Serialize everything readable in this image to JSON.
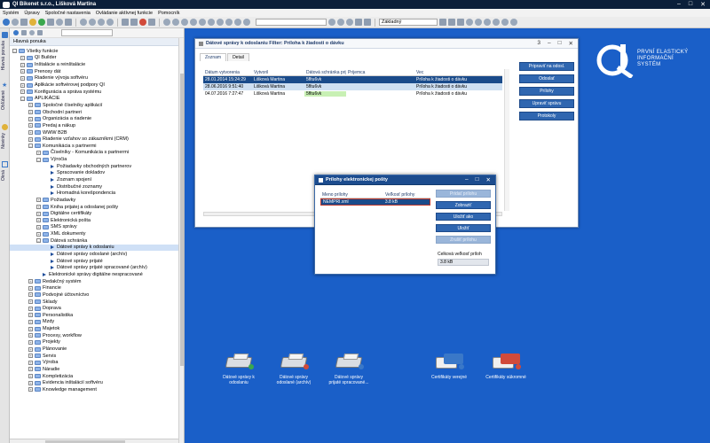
{
  "window": {
    "title": "QI  Bikenet s.r.o., Lišková Martina",
    "controls": [
      "–",
      "□",
      "✕"
    ]
  },
  "menu": [
    "Systém",
    "Úpravy",
    "Spoločné nastavenia",
    "Ovládanie aktívnej funkcie",
    "Pomocník"
  ],
  "toolbar": {
    "combo1": "",
    "combo2": "Základný"
  },
  "left_strip": [
    "Hlavná ponuka",
    "Obľúbené",
    "Novinky",
    "Okná"
  ],
  "left_panel": {
    "title": "Hlavná ponuka",
    "tree": [
      {
        "d": 0,
        "k": "fold",
        "e": "–",
        "t": "Všetky funkcie"
      },
      {
        "d": 1,
        "k": "fold",
        "e": "+",
        "t": "QI Builder"
      },
      {
        "d": 1,
        "k": "fold",
        "e": "+",
        "t": "Inštalácie a reinštalácie"
      },
      {
        "d": 1,
        "k": "fold",
        "e": "+",
        "t": "Prenosy dát"
      },
      {
        "d": 1,
        "k": "fold",
        "e": "+",
        "t": "Riadenie vývoja softvéru"
      },
      {
        "d": 1,
        "k": "fold",
        "e": "+",
        "t": "Aplikácie softvérovej podpory QI"
      },
      {
        "d": 1,
        "k": "fold",
        "e": "+",
        "t": "Konfigurácia a správa systému"
      },
      {
        "d": 1,
        "k": "fold",
        "e": "–",
        "t": "APLIKÁCIE"
      },
      {
        "d": 2,
        "k": "fold",
        "e": "+",
        "t": "Spoločné číselníky aplikácií"
      },
      {
        "d": 2,
        "k": "fold",
        "e": "+",
        "t": "Obchodní partneri"
      },
      {
        "d": 2,
        "k": "fold",
        "e": "+",
        "t": "Organizácia a riadenie"
      },
      {
        "d": 2,
        "k": "fold",
        "e": "+",
        "t": "Predaj a nákup"
      },
      {
        "d": 2,
        "k": "fold",
        "e": "+",
        "t": "WWW B2B"
      },
      {
        "d": 2,
        "k": "fold",
        "e": "+",
        "t": "Riadenie vzťahov so zákazníkmi (CRM)"
      },
      {
        "d": 2,
        "k": "fold",
        "e": "–",
        "t": "Komunikácia s partnermi"
      },
      {
        "d": 3,
        "k": "fold",
        "e": "+",
        "t": "Číselníky - Komunikácia s partnermi"
      },
      {
        "d": 3,
        "k": "fold",
        "e": "–",
        "t": "Výročia"
      },
      {
        "d": 4,
        "k": "leaf",
        "e": "",
        "t": "Požiadavky obchodných partnerov"
      },
      {
        "d": 4,
        "k": "leaf",
        "e": "",
        "t": "Spracovanie dokladov"
      },
      {
        "d": 4,
        "k": "leaf",
        "e": "",
        "t": "Zoznam spojení"
      },
      {
        "d": 4,
        "k": "leaf",
        "e": "",
        "t": "Distribučné zoznamy"
      },
      {
        "d": 4,
        "k": "leaf",
        "e": "",
        "t": "Hromadná korešpondencia"
      },
      {
        "d": 3,
        "k": "fold",
        "e": "+",
        "t": "Požiadavky"
      },
      {
        "d": 3,
        "k": "fold",
        "e": "+",
        "t": "Kniha prijatej a odoslanej pošty"
      },
      {
        "d": 3,
        "k": "fold",
        "e": "+",
        "t": "Digitálne certifikáty"
      },
      {
        "d": 3,
        "k": "fold",
        "e": "+",
        "t": "Elektronická pošta"
      },
      {
        "d": 3,
        "k": "fold",
        "e": "+",
        "t": "SMS správy"
      },
      {
        "d": 3,
        "k": "fold",
        "e": "+",
        "t": "XML dokumenty"
      },
      {
        "d": 3,
        "k": "fold",
        "e": "–",
        "t": "Dátová schránka"
      },
      {
        "d": 4,
        "k": "leaf",
        "e": "",
        "t": "Dátové správy k odoslaniu",
        "sel": true
      },
      {
        "d": 4,
        "k": "leaf",
        "e": "",
        "t": "Dátové správy odoslané (archív)"
      },
      {
        "d": 4,
        "k": "leaf",
        "e": "",
        "t": "Dátové správy prijaté"
      },
      {
        "d": 4,
        "k": "leaf",
        "e": "",
        "t": "Dátové správy prijaté spracované (archív)"
      },
      {
        "d": 3,
        "k": "leaf",
        "e": "",
        "t": "Elektronické správy digitálne nespracované"
      },
      {
        "d": 2,
        "k": "fold",
        "e": "+",
        "t": "Redakčný systém"
      },
      {
        "d": 2,
        "k": "fold",
        "e": "+",
        "t": "Financie"
      },
      {
        "d": 2,
        "k": "fold",
        "e": "+",
        "t": "Podvojné účtovníctvo"
      },
      {
        "d": 2,
        "k": "fold",
        "e": "+",
        "t": "Sklady"
      },
      {
        "d": 2,
        "k": "fold",
        "e": "+",
        "t": "Doprava"
      },
      {
        "d": 2,
        "k": "fold",
        "e": "+",
        "t": "Personalistika"
      },
      {
        "d": 2,
        "k": "fold",
        "e": "+",
        "t": "Mzdy"
      },
      {
        "d": 2,
        "k": "fold",
        "e": "+",
        "t": "Majetok"
      },
      {
        "d": 2,
        "k": "fold",
        "e": "+",
        "t": "Procesy, workflow"
      },
      {
        "d": 2,
        "k": "fold",
        "e": "+",
        "t": "Projekty"
      },
      {
        "d": 2,
        "k": "fold",
        "e": "+",
        "t": "Plánovanie"
      },
      {
        "d": 2,
        "k": "fold",
        "e": "+",
        "t": "Servis"
      },
      {
        "d": 2,
        "k": "fold",
        "e": "+",
        "t": "Výroba"
      },
      {
        "d": 2,
        "k": "fold",
        "e": "+",
        "t": "Náradie"
      },
      {
        "d": 2,
        "k": "fold",
        "e": "+",
        "t": "Kompletizácia"
      },
      {
        "d": 2,
        "k": "fold",
        "e": "+",
        "t": "Evidencia inštalácií softvéru"
      },
      {
        "d": 2,
        "k": "fold",
        "e": "+",
        "t": "Knowledge management"
      }
    ]
  },
  "main_window": {
    "title": "Dátové správy k odoslaniu  Filter: Príloha k žiadosti o dávku",
    "counter": "3",
    "controls": [
      "–",
      "□",
      "✕"
    ],
    "tabs": [
      "Zoznam",
      "Detail"
    ],
    "columns": [
      "Dátum vytvorenia",
      "Vytvoril",
      "Dátová schránka prijemcu",
      "Prijemca",
      "Vec"
    ],
    "rows": [
      [
        "28.01.2014 15:24:29",
        "Lišková Martina",
        "5fltu6vk",
        "",
        "Príloha k žiadosti o dávku"
      ],
      [
        "28.06.2016 9:51:40",
        "Lišková Martina",
        "5fltu6vk",
        "",
        "Príloha k žiadosti o dávku"
      ],
      [
        "04.07.2016 7:27:47",
        "Lišková Martina",
        "5fltu6vk",
        "",
        "Príloha k žiadosti o dávku"
      ]
    ],
    "buttons": [
      "Pripraviť na odosl.",
      "Odoslať",
      "Prílohy",
      "Upraviť správu",
      "Protokoly"
    ]
  },
  "attach_window": {
    "title": "Prílohy elektronickej pošty",
    "controls": [
      "–",
      "□",
      "✕"
    ],
    "columns": [
      "Meno prílohy",
      "Veľkosť prílohy"
    ],
    "rows": [
      [
        "NEMPRI.xml",
        "3.8 kB"
      ]
    ],
    "buttons": [
      {
        "label": "Pridať prílohu",
        "enabled": false
      },
      {
        "label": "Zobraziť",
        "enabled": true
      },
      {
        "label": "Uložiť ako",
        "enabled": true
      },
      {
        "label": "Uložiť",
        "enabled": true
      },
      {
        "label": "Zrušiť prílohu",
        "enabled": false
      }
    ],
    "total_label": "Celková veľkosť príloh",
    "total_value": "3.8 kB"
  },
  "brand": {
    "lines": [
      "PRVNÍ ELASTICKÝ",
      "INFORMAČNÍ",
      "SYSTÉM"
    ]
  },
  "desktop_icons": [
    {
      "l1": "Dátové správy k",
      "l2": "odoslaniu",
      "type": "shred",
      "dot": "#3aa84e"
    },
    {
      "l1": "Dátové správy",
      "l2": "odoslané (archív)",
      "type": "shred",
      "dot": "#d14a3a"
    },
    {
      "l1": "Dátové správy",
      "l2": "prijaté spracované...",
      "type": "shred",
      "dot": "#3a78c8"
    },
    {
      "l1": "Certifikáty verejné",
      "l2": "",
      "type": "card",
      "dot": "#3a78c8"
    },
    {
      "l1": "Certifikáty súkromné",
      "l2": "",
      "type": "card",
      "dot": "#d14a3a"
    }
  ]
}
